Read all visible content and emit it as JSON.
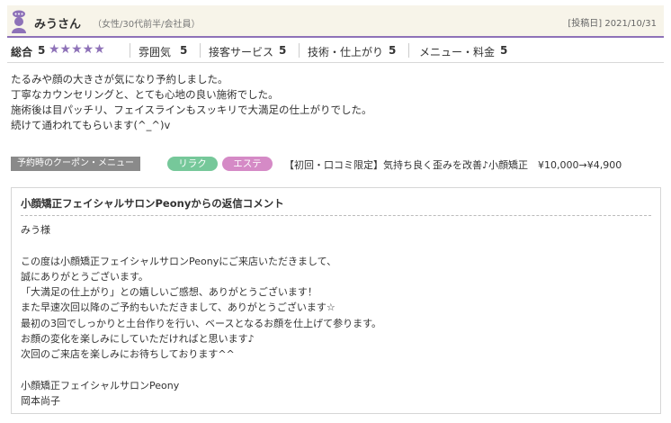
{
  "reviewer": {
    "name": "みうさん",
    "meta": "（女性/30代前半/会社員）",
    "post_date": "[投稿日] 2021/10/31"
  },
  "ratings": {
    "overall_label": "総合",
    "overall_value": "5",
    "stars_text": "★★★★★",
    "stars_count": 5,
    "items": [
      {
        "label": "雰囲気",
        "value": "5"
      },
      {
        "label": "接客サービス",
        "value": "5"
      },
      {
        "label": "技術・仕上がり",
        "value": "5"
      },
      {
        "label": "メニュー・料金",
        "value": "5"
      }
    ]
  },
  "review_lines": [
    "たるみや顔の大きさが気になり予約しました。",
    "丁寧なカウンセリングと、とても心地の良い施術でした。",
    "施術後は目パッチリ、フェイスラインもスッキリで大満足の仕上がりでした。",
    "続けて通われてもらいます(^_^)v"
  ],
  "coupon": {
    "label": "予約時のクーポン・メニュー",
    "tags": [
      "リラク",
      "エステ"
    ],
    "text": "【初回・口コミ限定】気持ち良く歪みを改善♪小顔矯正　¥10,000→¥4,900"
  },
  "reply": {
    "title": "小顔矯正フェイシャルサロンPeonyからの返信コメント",
    "lines": [
      "みう様",
      "",
      "この度は小顔矯正フェイシャルサロンPeonyにご来店いただきまして、",
      "誠にありがとうございます。",
      "「大満足の仕上がり」との嬉しいご感想、ありがとうございます！",
      "また早速次回以降のご予約もいただきまして、ありがとうございます☆",
      "最初の3回でしっかりと土台作りを行い、ベースとなるお顔を仕上げて参ります。",
      "お顔の変化を楽しみにしていただければと思います♪",
      "次回のご来店を楽しみにお待ちしております^^",
      "",
      "小顔矯正フェイシャルサロンPeony",
      "岡本尚子"
    ]
  },
  "colors": {
    "accent": "#8e72b8",
    "header_bg": "#f7f4e9",
    "tag_relax": "#76c89a",
    "tag_esthe": "#d58ac6",
    "coupon_label_bg": "#8a8a8a"
  },
  "icons": {
    "avatar": "user-avatar-icon"
  }
}
